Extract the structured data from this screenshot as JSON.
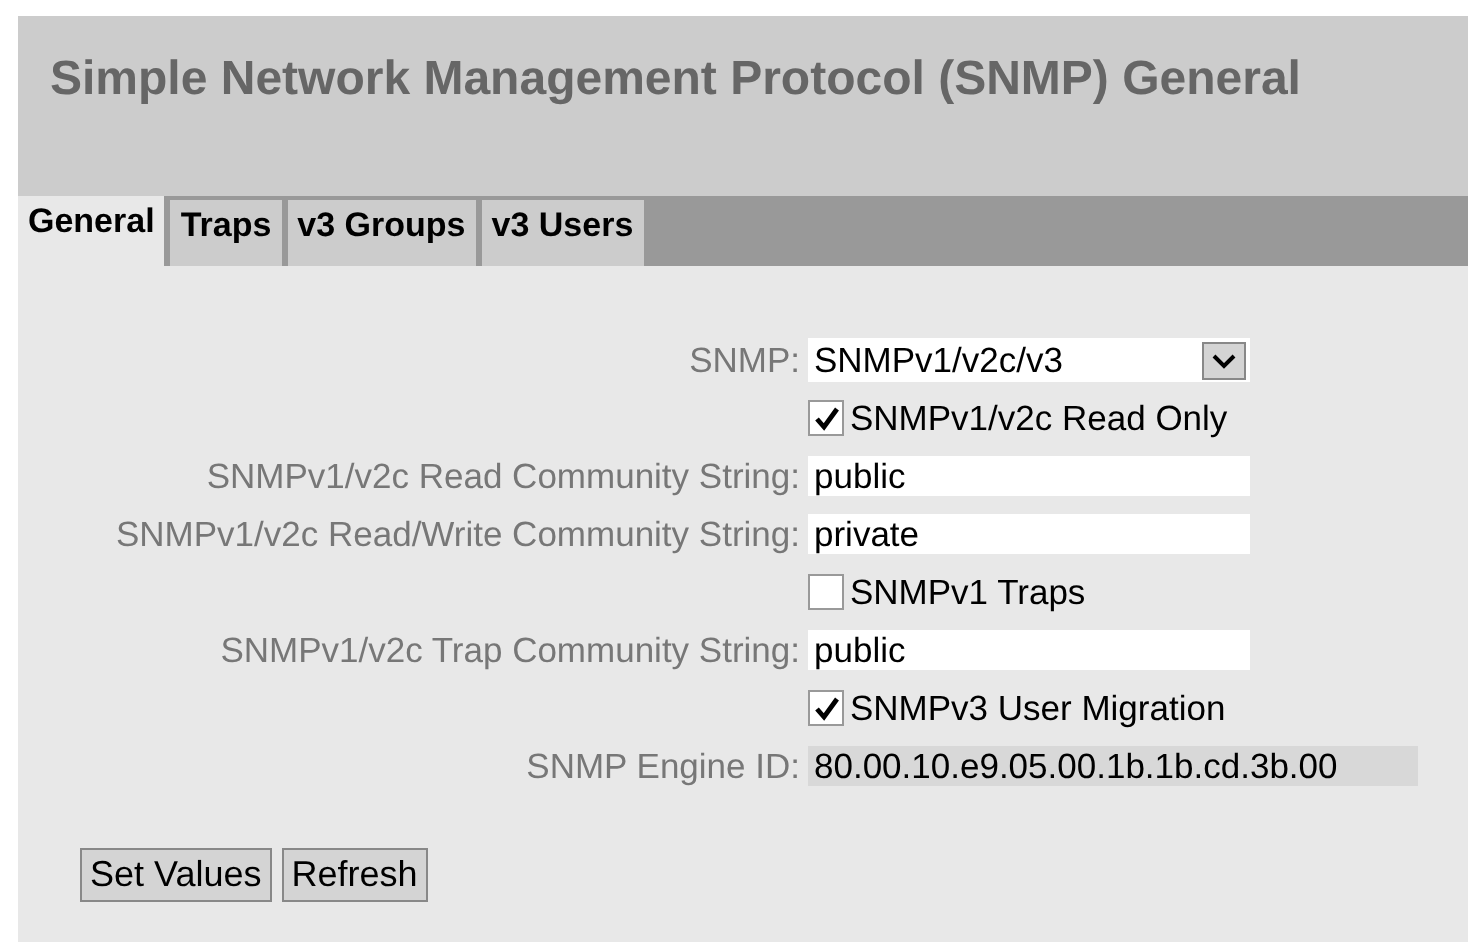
{
  "page_title": "Simple Network Management Protocol (SNMP) General",
  "tabs": [
    {
      "label": "General",
      "selected": true
    },
    {
      "label": "Traps",
      "selected": false
    },
    {
      "label": "v3 Groups",
      "selected": false
    },
    {
      "label": "v3 Users",
      "selected": false
    }
  ],
  "fields": [
    {
      "kind": "select",
      "label": "SNMP:",
      "value": "SNMPv1/v2c/v3"
    },
    {
      "kind": "checkbox",
      "label": "SNMPv1/v2c Read Only",
      "checked": true
    },
    {
      "kind": "text",
      "label": "SNMPv1/v2c Read Community String:",
      "value": "public"
    },
    {
      "kind": "text",
      "label": "SNMPv1/v2c Read/Write Community String:",
      "value": "private"
    },
    {
      "kind": "checkbox",
      "label": "SNMPv1 Traps",
      "checked": false
    },
    {
      "kind": "text",
      "label": "SNMPv1/v2c Trap Community String:",
      "value": "public"
    },
    {
      "kind": "checkbox",
      "label": "SNMPv3 User Migration",
      "checked": true
    },
    {
      "kind": "readonly",
      "label": "SNMP Engine ID:",
      "value": "80.00.10.e9.05.00.1b.1b.cd.3b.00"
    }
  ],
  "buttons": [
    "Set Values",
    "Refresh"
  ]
}
